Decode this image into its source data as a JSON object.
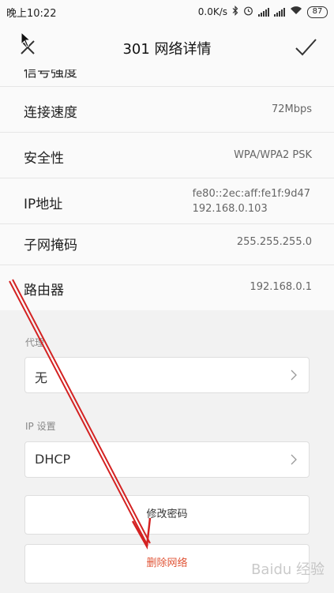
{
  "status_bar": {
    "time": "晚上10:22",
    "net_speed": "0.0K/s",
    "battery": "87"
  },
  "header": {
    "title": "301  网络详情"
  },
  "details": {
    "partial_row_label": "信号强度",
    "rows": [
      {
        "label": "连接速度",
        "value": "72Mbps"
      },
      {
        "label": "安全性",
        "value": "WPA/WPA2 PSK"
      },
      {
        "label": "IP地址",
        "value_line1": "fe80::2ec:aff:fe1f:9d47",
        "value_line2": "192.168.0.103"
      },
      {
        "label": "子网掩码",
        "value": "255.255.255.0"
      },
      {
        "label": "路由器",
        "value": "192.168.0.1"
      }
    ]
  },
  "proxy": {
    "label": "代理",
    "value": "无"
  },
  "ip_settings": {
    "label": "IP 设置",
    "value": "DHCP"
  },
  "buttons": {
    "modify_password": "修改密码",
    "delete_network": "删除网络"
  },
  "watermark": "Baidu 经验",
  "colors": {
    "danger": "#e05537",
    "annotation_arrow": "#d42222"
  }
}
